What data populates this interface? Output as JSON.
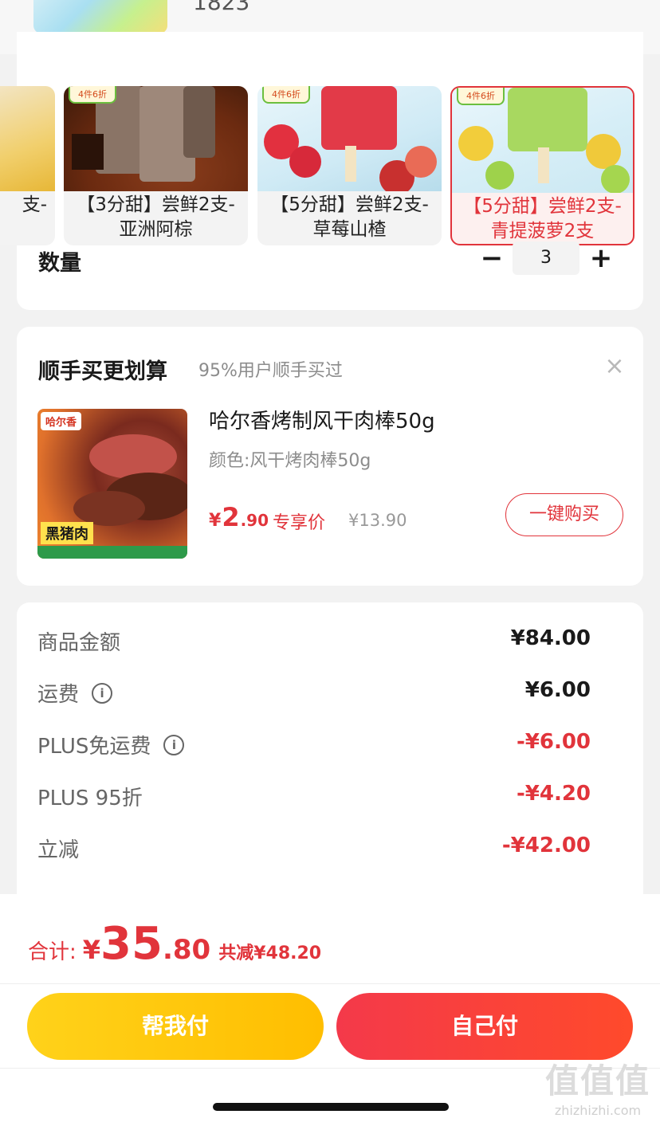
{
  "top": {
    "number": "1823"
  },
  "variants": [
    {
      "label": "支-",
      "tag": "",
      "selected": false
    },
    {
      "label": "【3分甜】尝鲜2支-亚洲阿棕",
      "tag": "4件6折",
      "selected": false
    },
    {
      "label": "【5分甜】尝鲜2支-草莓山楂",
      "tag": "4件6折",
      "selected": false
    },
    {
      "label": "【5分甜】尝鲜2支-青提菠萝2支",
      "tag": "4件6折",
      "selected": true
    }
  ],
  "variant_labels_lines": [
    [
      "支-"
    ],
    [
      "【3分甜】尝鲜2支-",
      "亚洲阿棕"
    ],
    [
      "【5分甜】尝鲜2支-",
      "草莓山楂"
    ],
    [
      "【5分甜】尝鲜2支-",
      "青提菠萝2支"
    ]
  ],
  "quantity": {
    "label": "数量",
    "minus": "−",
    "value": "3",
    "plus": "+"
  },
  "upsell": {
    "title": "顺手买更划算",
    "subtitle": "95%用户顺手买过",
    "close": "×",
    "product": {
      "brand": "哈尔香",
      "badge": "黑猪肉",
      "name": "哈尔香烤制风干肉棒50g",
      "spec": "颜色:风干烤肉棒50g",
      "price_currency": "¥",
      "price_int": "2",
      "price_dec": ".90",
      "price_label": "专享价",
      "original_price": "¥13.90",
      "buy_button": "一键购买"
    }
  },
  "summary": {
    "rows": [
      {
        "label": "商品金额",
        "value": "¥84.00",
        "red": false,
        "info": false
      },
      {
        "label": "运费",
        "value": "¥6.00",
        "red": false,
        "info": true
      },
      {
        "label": "PLUS免运费",
        "value": "-¥6.00",
        "red": true,
        "info": true
      },
      {
        "label": "PLUS 95折",
        "value": "-¥4.20",
        "red": true,
        "info": false
      },
      {
        "label": "立减",
        "value": "-¥42.00",
        "red": true,
        "info": false
      }
    ]
  },
  "footer": {
    "total_label": "合计:",
    "total_currency": "¥",
    "total_int": "35",
    "total_dec": ".80",
    "saved": "共减¥48.20",
    "help_pay": "帮我付",
    "self_pay": "自己付",
    "watermark_logo": "值值值",
    "watermark_url": "zhizhizhi.com"
  },
  "colors": {
    "accent_red": "#e1343b",
    "yellow_button": "#ffc81a",
    "red_button": "#f4394a"
  }
}
